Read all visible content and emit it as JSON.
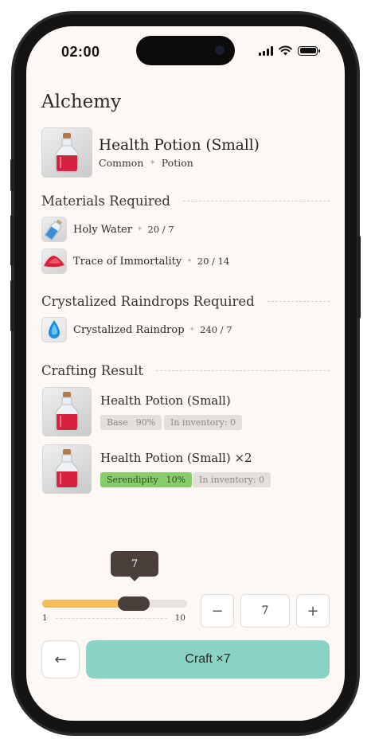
{
  "status_bar": {
    "time": "02:00"
  },
  "page": {
    "title": "Alchemy"
  },
  "item": {
    "name": "Health Potion (Small)",
    "rarity": "Common",
    "category": "Potion",
    "icon": "red-potion-bottle-icon"
  },
  "materials": {
    "heading": "Materials Required",
    "items": [
      {
        "name": "Holy Water",
        "qty": "20 / 7",
        "icon": "holy-water-vial-icon"
      },
      {
        "name": "Trace of Immortality",
        "qty": "20 / 14",
        "icon": "red-powder-icon"
      }
    ]
  },
  "raindrops": {
    "heading": "Crystalized Raindrops Required",
    "items": [
      {
        "name": "Crystalized Raindrop",
        "qty": "240 / 7",
        "icon": "blue-droplet-icon"
      }
    ]
  },
  "results": {
    "heading": "Crafting Result",
    "items": [
      {
        "name": "Health Potion (Small)",
        "tag_label": "Base",
        "tag_value": "90%",
        "inventory": "In inventory: 0",
        "tag_color": "#e4dfdb"
      },
      {
        "name": "Health Potion (Small) ×2",
        "tag_label": "Serendipity",
        "tag_value": "10%",
        "inventory": "In inventory: 0",
        "tag_color": "#88cc6c"
      }
    ]
  },
  "quantity": {
    "tooltip": "7",
    "min": "1",
    "max": "10",
    "value": "7",
    "slider_value": 7,
    "minus_label": "−",
    "plus_label": "+"
  },
  "actions": {
    "back_label": "←",
    "craft_label": "Craft ×7",
    "craft_color": "#89d3c4"
  }
}
